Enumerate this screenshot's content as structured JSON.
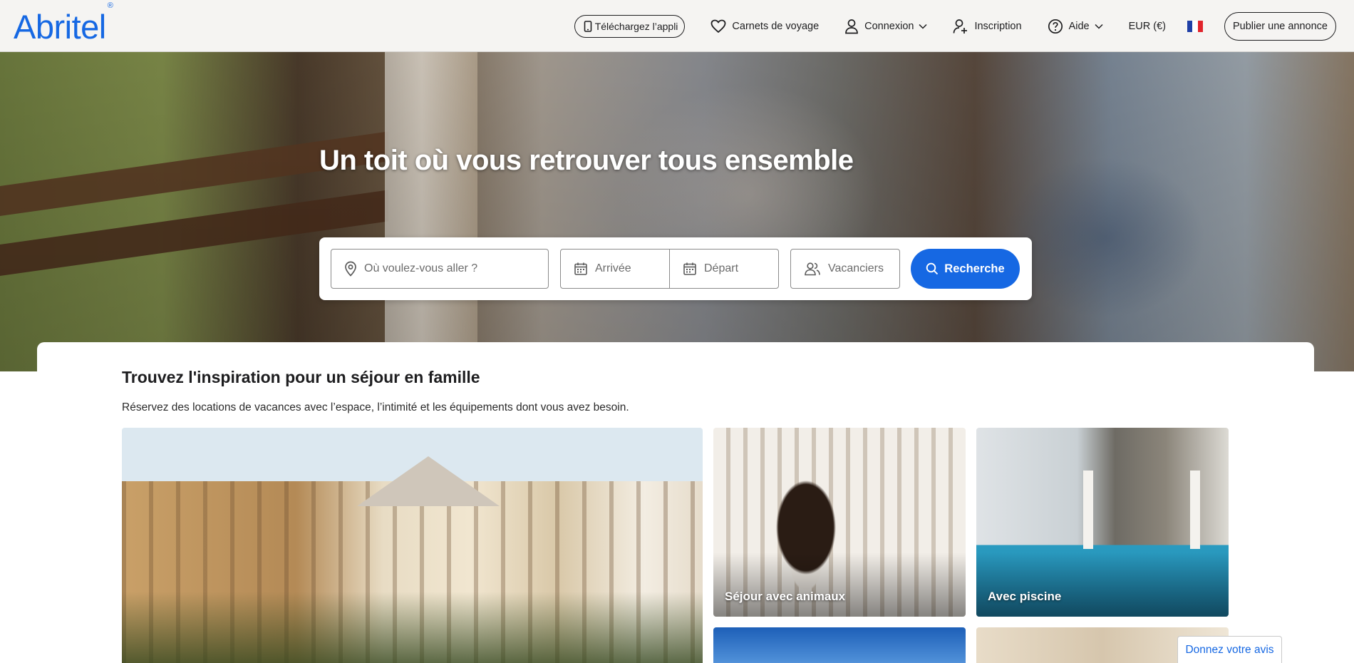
{
  "brand": {
    "logo_text": "Abritel",
    "logo_mark": "®",
    "accent": "#1668e3"
  },
  "nav": {
    "app_button": "Téléchargez l’appli",
    "trips": "Carnets de voyage",
    "signin": "Connexion",
    "signup": "Inscription",
    "help": "Aide",
    "currency": "EUR (€)",
    "language_flag": "france-flag-icon",
    "publish": "Publier une annonce"
  },
  "hero": {
    "title": "Un toit où vous retrouver tous ensemble",
    "search": {
      "destination_placeholder": "Où voulez-vous aller ?",
      "checkin_placeholder": "Arrivée",
      "checkout_placeholder": "Départ",
      "travelers_placeholder": "Vacanciers",
      "button": "Recherche"
    }
  },
  "inspiration": {
    "title": "Trouvez l'inspiration pour un séjour en famille",
    "subtitle": "Réservez des locations de vacances avec l’espace, l’intimité et les équipements dont vous avez besoin.",
    "tiles": [
      {
        "label": ""
      },
      {
        "label": "Séjour avec animaux"
      },
      {
        "label": "Avec piscine"
      }
    ]
  },
  "feedback": {
    "label": "Donnez votre avis"
  }
}
